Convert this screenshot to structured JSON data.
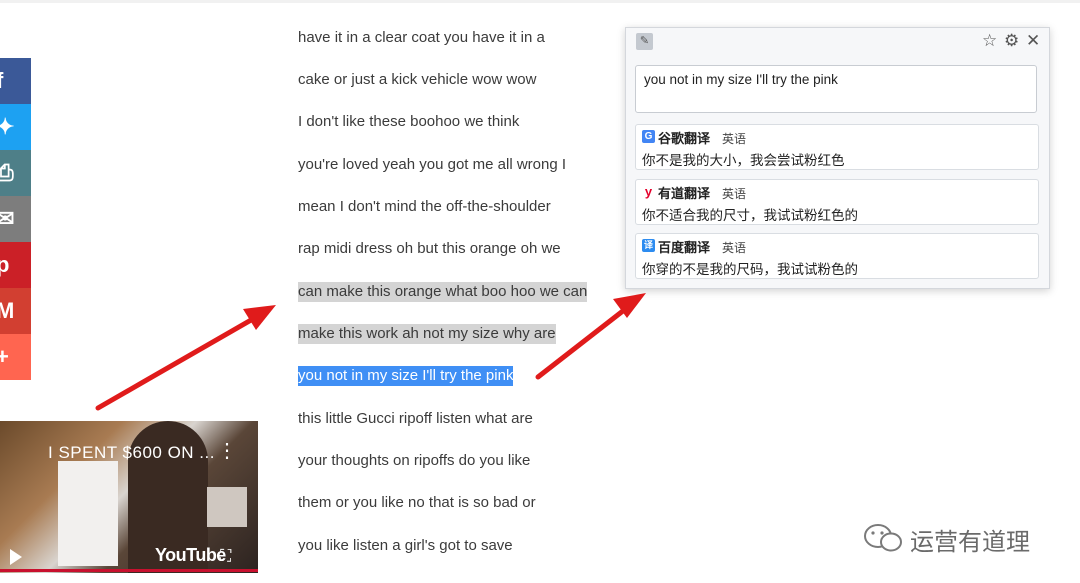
{
  "share_buttons": [
    {
      "icon": "facebook-icon",
      "glyph": "f",
      "color": "#3b5998"
    },
    {
      "icon": "twitter-icon",
      "glyph": "✦",
      "color": "#1da1f2"
    },
    {
      "icon": "print-icon",
      "glyph": "⎙",
      "color": "#4e7f88"
    },
    {
      "icon": "email-icon",
      "glyph": "✉",
      "color": "#7d7d7d"
    },
    {
      "icon": "pinterest-icon",
      "glyph": "p",
      "color": "#cb2027"
    },
    {
      "icon": "gmail-icon",
      "glyph": "M",
      "color": "#d23f31"
    },
    {
      "icon": "more-icon",
      "glyph": "+",
      "color": "#ff6550"
    }
  ],
  "transcript": [
    "have it in a clear coat you have it in a",
    "cake or just a kick vehicle wow wow",
    "I don't like these boohoo we think",
    "you're loved yeah you got me all wrong I",
    "mean I don't mind the off-the-shoulder",
    "rap midi dress oh but this orange oh we",
    "can make this orange what boo hoo we can",
    "make this work ah not my size why are",
    "you not in my size I'll try the pink",
    "this little Gucci ripoff listen what are",
    "your thoughts on ripoffs do you like",
    "them or you like no that is so bad or",
    "you like listen a girl's got to save"
  ],
  "video": {
    "title": "I SPENT $600 ON ...",
    "logo": "YouTube"
  },
  "popup": {
    "input_text": "you not in my size I'll try the pink",
    "results": [
      {
        "engine": "谷歌翻译",
        "lang": "英语",
        "text": "你不是我的大小，我会尝试粉红色",
        "badge": "G",
        "badge_color": "#4285f4"
      },
      {
        "engine": "有道翻译",
        "lang": "英语",
        "text": "你不适合我的尺寸，我试试粉红色的",
        "badge": "y",
        "badge_color": "#e4002b"
      },
      {
        "engine": "百度翻译",
        "lang": "英语",
        "text": "你穿的不是我的尺码，我试试粉色的",
        "badge": "译",
        "badge_color": "#2d8cf0"
      }
    ]
  },
  "watermark": "运营有道理"
}
